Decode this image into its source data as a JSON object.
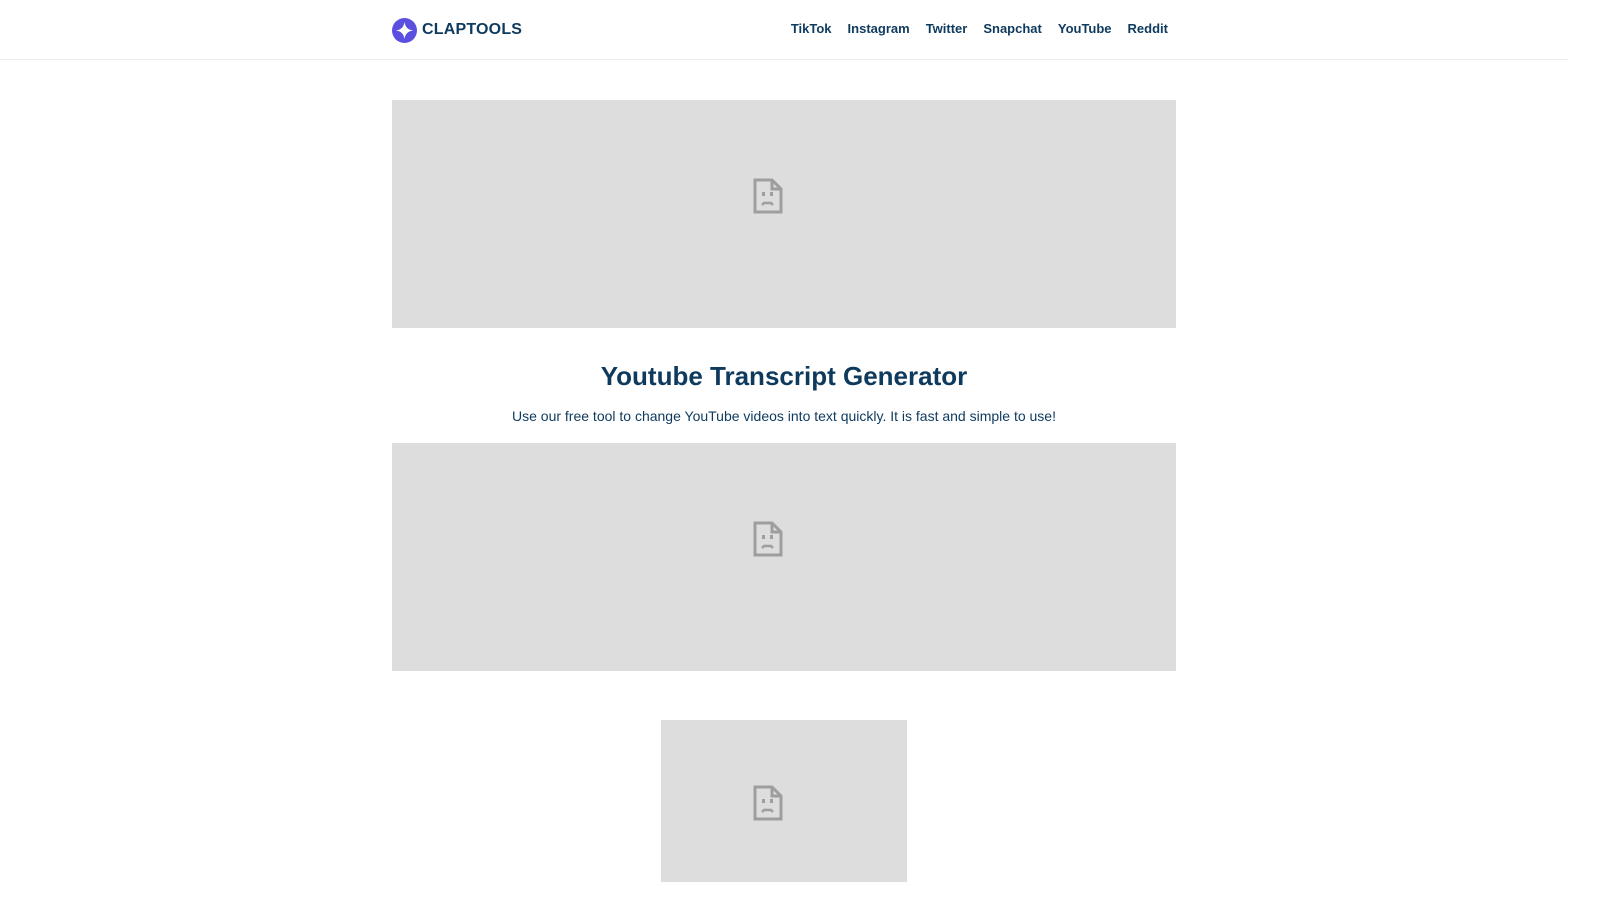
{
  "brand": {
    "name": "CLAPTOOLS",
    "logo_icon": "sparkle-star-icon",
    "accent_color": "#5b4fe0",
    "text_color": "#0e3a5e"
  },
  "nav": {
    "items": [
      {
        "label": "TikTok"
      },
      {
        "label": "Instagram"
      },
      {
        "label": "Twitter"
      },
      {
        "label": "Snapchat"
      },
      {
        "label": "YouTube"
      },
      {
        "label": "Reddit"
      }
    ]
  },
  "hero": {
    "title": "Youtube Transcript Generator",
    "subtitle": "Use our free tool to change YouTube videos into text quickly. It is fast and simple to use!"
  },
  "placeholders": {
    "icon": "broken-image-icon",
    "background_color": "#dddddd",
    "icon_color": "#9e9e9e"
  }
}
